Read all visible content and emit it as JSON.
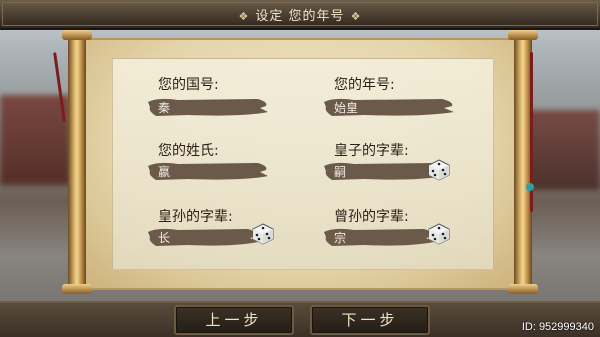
{
  "title": "设定 您的年号",
  "fields": {
    "country": {
      "label": "您的国号:",
      "value": "秦"
    },
    "era": {
      "label": "您的年号:",
      "value": "始皇"
    },
    "surname": {
      "label": "您的姓氏:",
      "value": "嬴"
    },
    "prince_name": {
      "label": "皇子的字辈:",
      "value": "嗣"
    },
    "grandson_name": {
      "label": "皇孙的字辈:",
      "value": "长"
    },
    "greatgrandson_name": {
      "label": "曾孙的字辈:",
      "value": "宗"
    }
  },
  "buttons": {
    "prev": "上一步",
    "next": "下一步"
  },
  "user_id": "ID: 952999340",
  "colors": {
    "brush": "#6b5a4a",
    "paper": "#e9dcb7",
    "gold": "#d9b46a"
  }
}
